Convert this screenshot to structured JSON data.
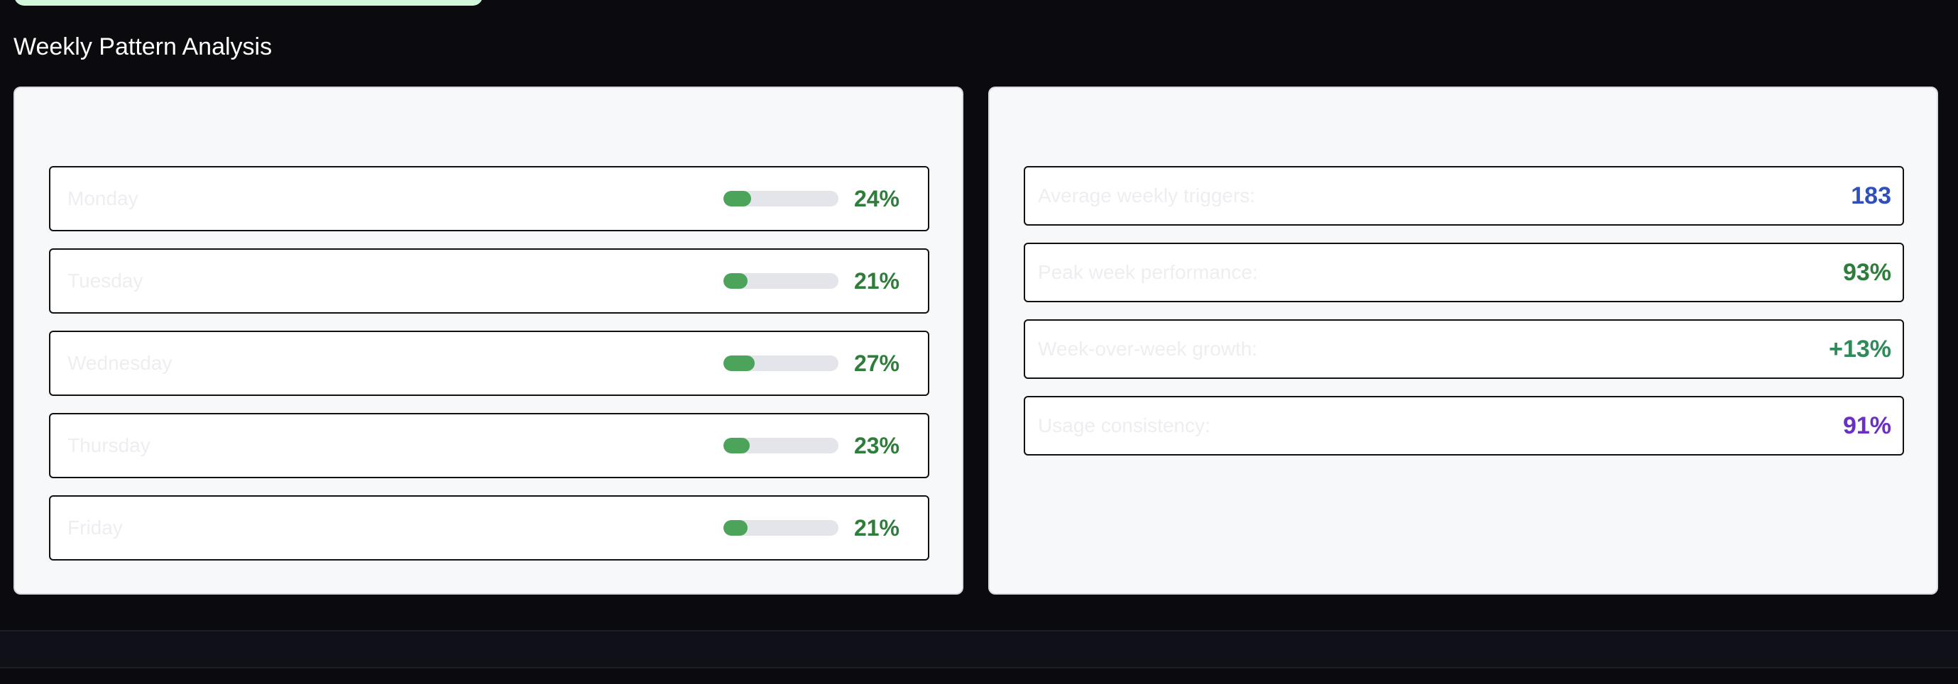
{
  "section": {
    "title": "Weekly Pattern Analysis"
  },
  "days": [
    {
      "label": "Monday",
      "percent_text": "24%",
      "fill_fraction": 0.24
    },
    {
      "label": "Tuesday",
      "percent_text": "21%",
      "fill_fraction": 0.21
    },
    {
      "label": "Wednesday",
      "percent_text": "27%",
      "fill_fraction": 0.27
    },
    {
      "label": "Thursday",
      "percent_text": "23%",
      "fill_fraction": 0.23
    },
    {
      "label": "Friday",
      "percent_text": "21%",
      "fill_fraction": 0.21
    }
  ],
  "stats": [
    {
      "label": "Average weekly triggers:",
      "value": "183",
      "color": "#2f4fbf"
    },
    {
      "label": "Peak week performance:",
      "value": "93%",
      "color": "#2f7d3a"
    },
    {
      "label": "Week-over-week growth:",
      "value": "+13%",
      "color": "#2f8a5a"
    },
    {
      "label": "Usage consistency:",
      "value": "91%",
      "color": "#6a2fc4"
    }
  ],
  "colors": {
    "bar_fill": "#4ca35a",
    "bar_track": "#e3e5ea",
    "percent_text": "#2f7d3a"
  }
}
